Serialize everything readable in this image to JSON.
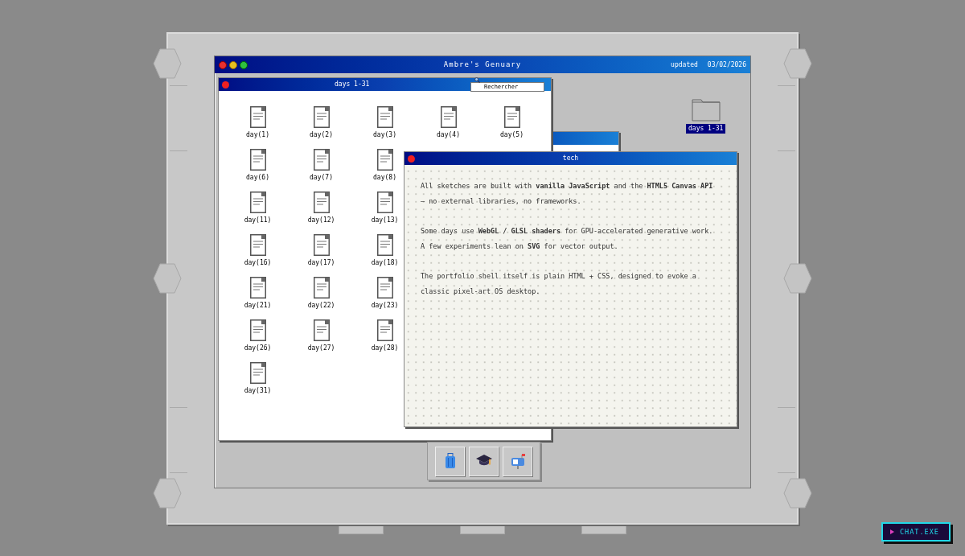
{
  "desktop_window": {
    "title": "Ambre's Genuary",
    "updated_label": "updated",
    "updated_date": "03/02/2026"
  },
  "days_window": {
    "title": "days 1-31",
    "search": {
      "placeholder": "Rechercher"
    },
    "rows": [
      [
        {
          "label": "day(1)"
        },
        {
          "label": "day(2)"
        },
        {
          "label": "day(3)"
        },
        {
          "label": "day(4)"
        },
        {
          "label": "day(5)"
        }
      ],
      [
        {
          "label": "day(6)"
        },
        {
          "label": "day(7)"
        },
        {
          "label": "day(8)"
        }
      ],
      [
        {
          "label": "day(11)"
        },
        {
          "label": "day(12)"
        },
        {
          "label": "day(13)"
        }
      ],
      [
        {
          "label": "day(16)"
        },
        {
          "label": "day(17)"
        },
        {
          "label": "day(18)"
        }
      ],
      [
        {
          "label": "day(21)"
        },
        {
          "label": "day(22)"
        },
        {
          "label": "day(23)"
        }
      ],
      [
        {
          "label": "day(26)"
        },
        {
          "label": "day(27)"
        },
        {
          "label": "day(28)"
        }
      ],
      [
        {
          "label": "day(31)"
        }
      ]
    ]
  },
  "tech_window": {
    "title": "tech",
    "paragraphs": [
      "All sketches are built with **vanilla JavaScript** and the **HTML5 Canvas API** — no external libraries, no frameworks.",
      "Some days use **WebGL / GLSL shaders** for GPU-accelerated generative work. A few experiments lean on **SVG** for vector output.",
      "The portfolio shell itself is plain HTML + CSS, designed to evoke a classic pixel-art OS desktop."
    ]
  },
  "desktop_folder": {
    "label": "days 1-31",
    "selected": true
  },
  "dock": [
    {
      "kind": "luggage"
    },
    {
      "kind": "graduation"
    },
    {
      "kind": "mailbox"
    }
  ],
  "chat_button": {
    "label": "CHAT.EXE"
  }
}
